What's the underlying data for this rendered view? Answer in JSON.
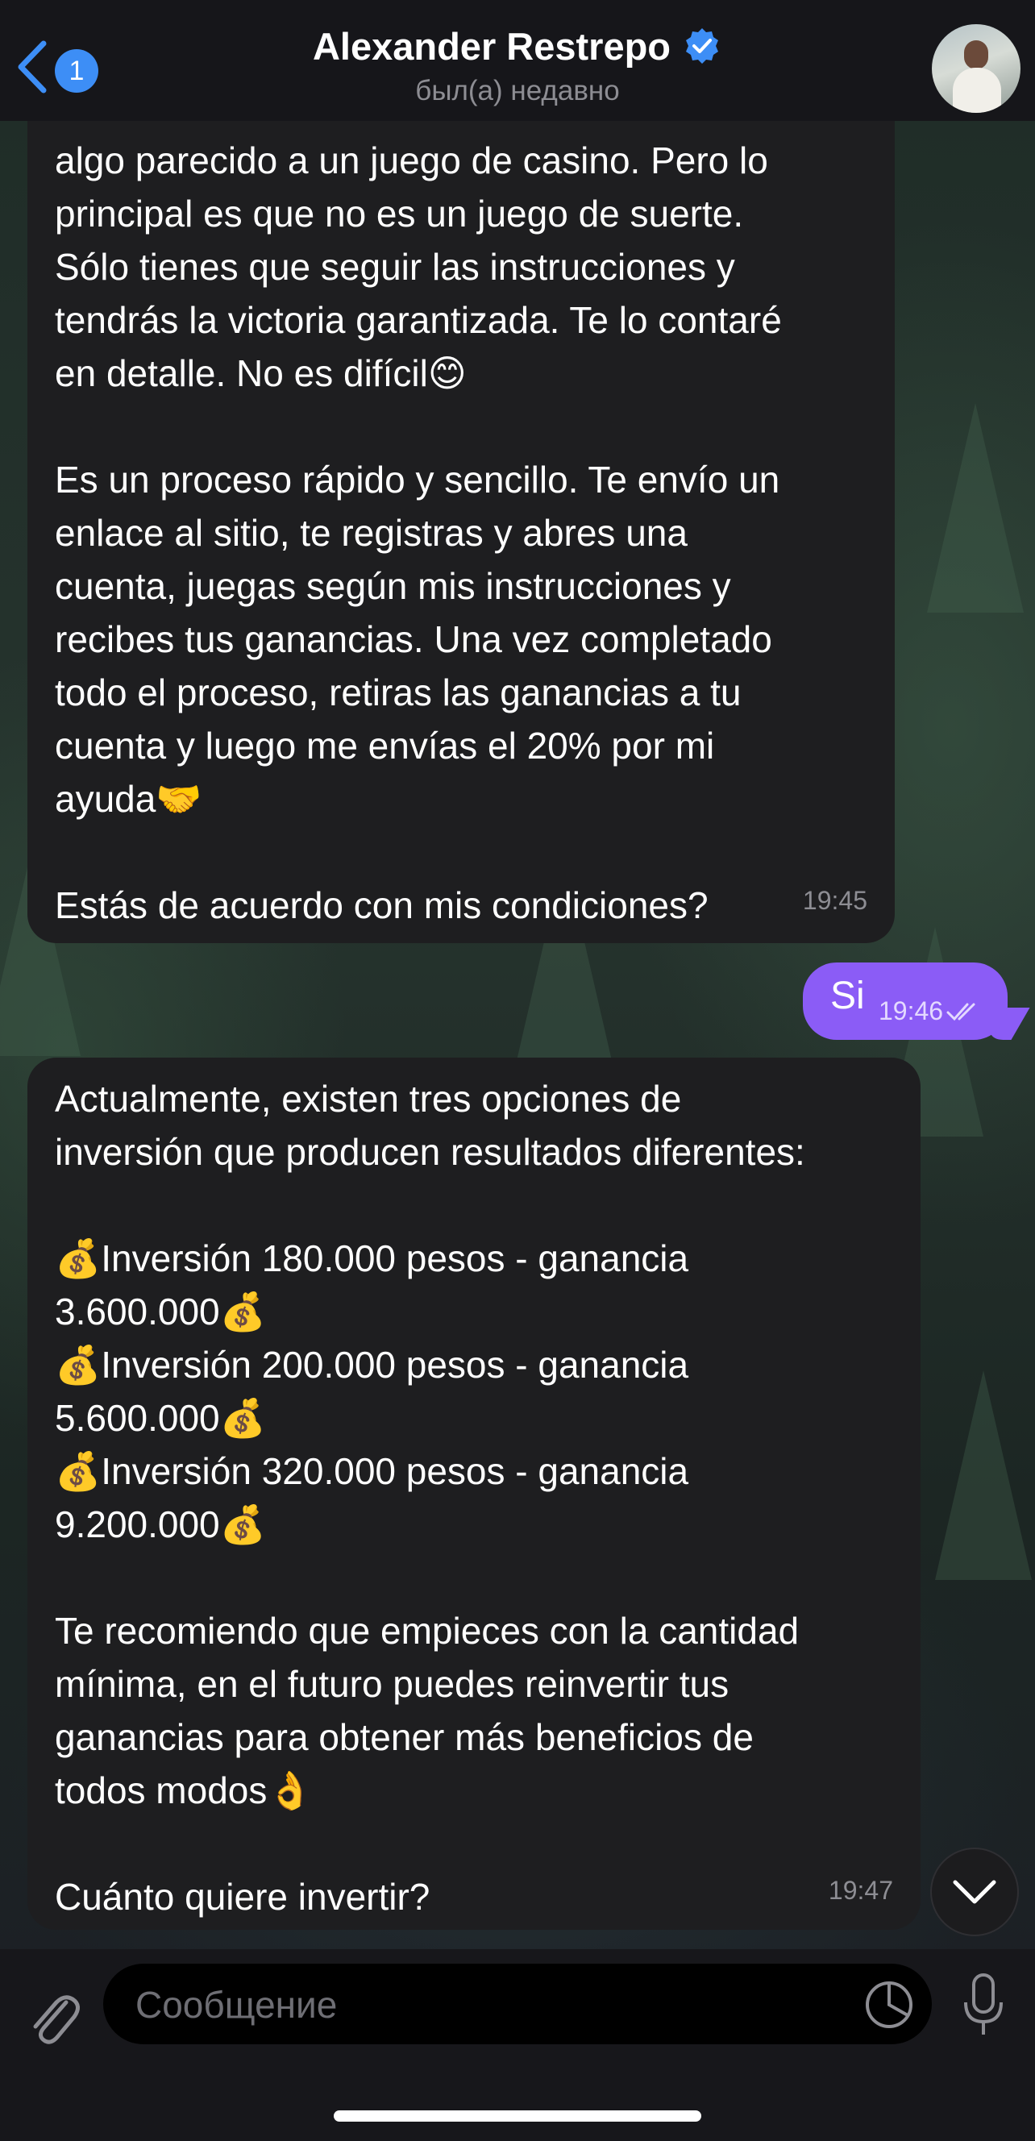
{
  "header": {
    "back_count": "1",
    "contact_name": "Alexander Restrepo",
    "status": "был(а) недавно"
  },
  "messages": {
    "m1": {
      "text": "algo parecido a un juego de casino. Pero lo\nprincipal es que no es un juego de suerte.\nSólo tienes que seguir las instrucciones y\ntendrás la victoria garantizada. Te lo contaré\nen detalle. No es difícil😊\n\nEs un proceso rápido y sencillo. Te envío un\nenlace al sitio, te registras y abres una\ncuenta, juegas según mis instrucciones y\nrecibes tus ganancias. Una vez completado\ntodo el proceso, retiras las ganancias a tu\ncuenta y luego me envías el 20% por mi\nayuda🤝\n\nEstás de acuerdo con mis condiciones?",
      "time": "19:45"
    },
    "m2": {
      "text": "Si",
      "time": "19:46"
    },
    "m3": {
      "text": "Actualmente, existen tres opciones de\ninversión que producen resultados diferentes:\n\n💰Inversión 180.000 pesos - ganancia\n3.600.000💰\n💰Inversión 200.000 pesos - ganancia\n5.600.000💰\n💰Inversión 320.000 pesos - ganancia\n9.200.000💰\n\nTe recomiendo que empieces con la cantidad\nmínima, en el futuro puedes reinvertir tus\nganancias para obtener más beneficios de\ntodos modos👌\n\nCuánto quiere invertir?",
      "time": "19:47"
    }
  },
  "composer": {
    "placeholder": "Сообщение"
  },
  "colors": {
    "accent": "#3d8ef6",
    "outgoing_bubble": "#8b5cf6",
    "incoming_bubble": "#1e1e20"
  },
  "icons": [
    "chevron-left-icon",
    "verified-icon",
    "chevron-down-icon",
    "paperclip-icon",
    "sticker-icon",
    "microphone-icon",
    "double-check-icon"
  ]
}
